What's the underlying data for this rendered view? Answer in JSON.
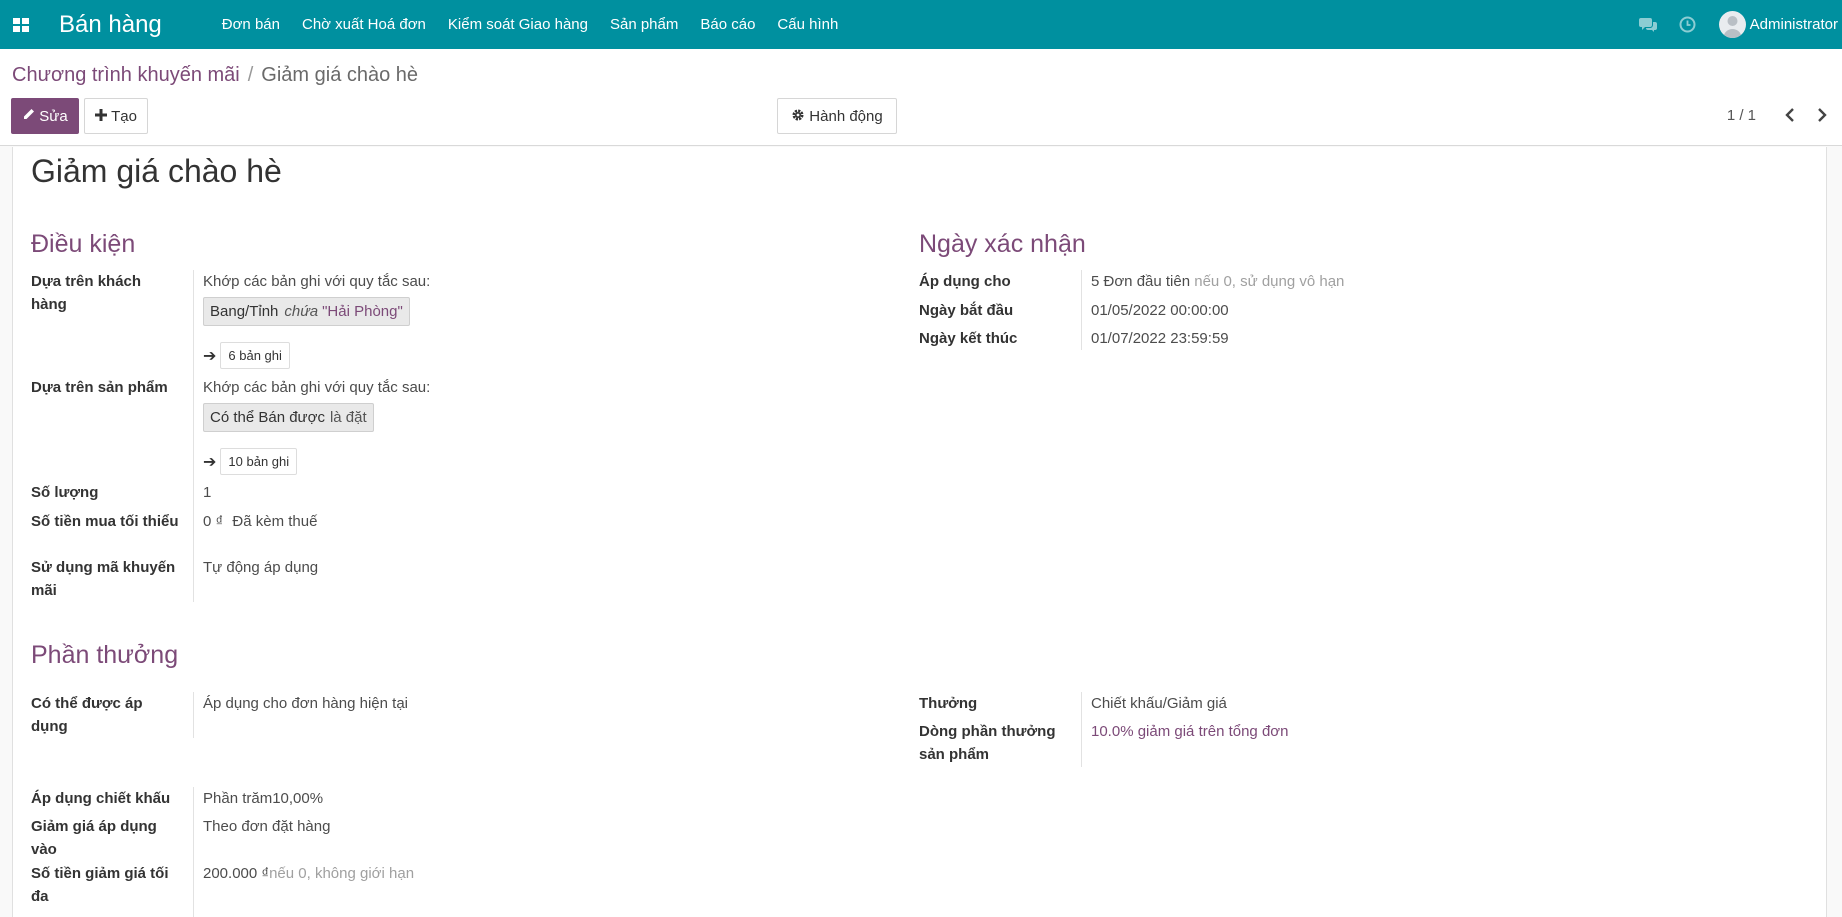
{
  "navbar": {
    "brand": "Bán hàng",
    "menu": [
      "Đơn bán",
      "Chờ xuất Hoá đơn",
      "Kiểm soát Giao hàng",
      "Sản phẩm",
      "Báo cáo",
      "Cấu hình"
    ],
    "user": "Administrator"
  },
  "breadcrumb": {
    "parent": "Chương trình khuyến mãi",
    "separator": "/",
    "current": "Giảm giá chào hè"
  },
  "toolbar": {
    "edit": "Sửa",
    "create": "Tạo",
    "action": "Hành động",
    "pager": "1 / 1"
  },
  "form": {
    "title": "Giảm giá chào hè",
    "conditions": {
      "heading": "Điều kiện",
      "customer_label": "Dựa trên khách hàng",
      "customer_rule_intro": "Khớp các bản ghi với quy tắc sau:",
      "customer_rule_field": "Bang/Tỉnh",
      "customer_rule_op": "chứa",
      "customer_rule_value": "\"Hải Phòng\"",
      "customer_records": "6 bản ghi",
      "product_label": "Dựa trên sản phẩm",
      "product_rule_intro": "Khớp các bản ghi với quy tắc sau:",
      "product_rule_field": "Có thể Bán được",
      "product_rule_op": "là đặt",
      "product_records": "10 bản ghi",
      "qty_label": "Số lượng",
      "qty_value": "1",
      "min_amount_label": "Số tiền mua tối thiểu",
      "min_amount_value": "0 ₫",
      "min_amount_tax": "Đã kèm thuế",
      "code_label": "Sử dụng mã khuyến mãi",
      "code_value": "Tự động áp dụng"
    },
    "validity": {
      "heading": "Ngày xác nhận",
      "apply_label": "Áp dụng cho",
      "apply_value": "5 Đơn đầu tiên",
      "apply_hint": "nếu 0, sử dụng vô hạn",
      "start_label": "Ngày bắt đầu",
      "start_value": "01/05/2022 00:00:00",
      "end_label": "Ngày kết thúc",
      "end_value": "01/07/2022 23:59:59"
    },
    "rewards": {
      "heading": "Phần thưởng",
      "applicable_label": "Có thể được áp dụng",
      "applicable_value": "Áp dụng cho đơn hàng hiện tại",
      "reward_label": "Thưởng",
      "reward_value": "Chiết khấu/Giảm giá",
      "reward_line_label": "Dòng phần thưởng sản phẩm",
      "reward_line_value": "10.0% giảm giá trên tổng đơn",
      "discount_label": "Áp dụng chiết khấu",
      "discount_value": "Phần trăm10,00%",
      "discount_on_label": "Giảm giá áp dụng vào",
      "discount_on_value": "Theo đơn đặt hàng",
      "max_label": "Số tiền giảm giá tối đa",
      "max_value": "200.000 ₫",
      "max_hint": "nếu 0, không giới hạn"
    }
  }
}
